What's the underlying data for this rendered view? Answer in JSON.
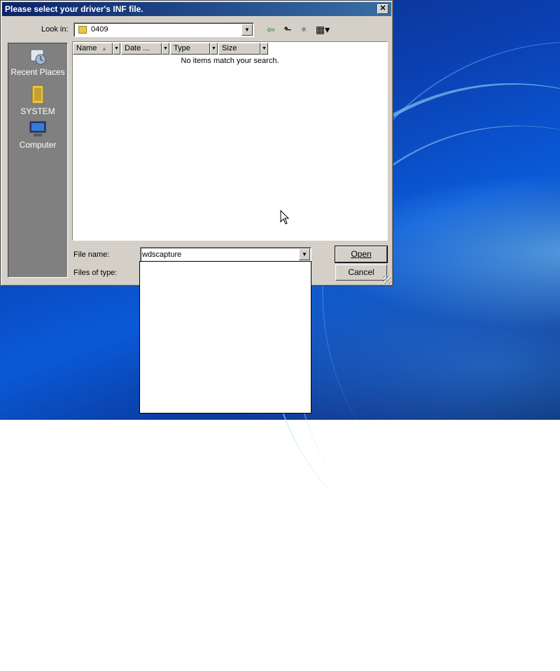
{
  "dialog": {
    "title": "Please select your driver's INF file.",
    "close_label": "✕"
  },
  "lookin": {
    "label": "Look in:",
    "value": "0409"
  },
  "toolbar": {
    "back_icon": "⇦",
    "up_icon": "⬑",
    "new_folder_icon": "✶",
    "view_icon": "▦▾"
  },
  "places": [
    {
      "label": "Recent Places",
      "icon": "recent-places-icon"
    },
    {
      "label": "SYSTEM",
      "icon": "user-folder-icon"
    },
    {
      "label": "Computer",
      "icon": "computer-icon"
    }
  ],
  "filelist": {
    "columns": [
      "Name",
      "Date ...",
      "Type",
      "Size"
    ],
    "empty_message": "No items match your search."
  },
  "form": {
    "file_name_label": "File name:",
    "file_name_value": "wdscapture",
    "files_of_type_label": "Files of type:",
    "open_label": "Open",
    "cancel_label": "Cancel"
  }
}
